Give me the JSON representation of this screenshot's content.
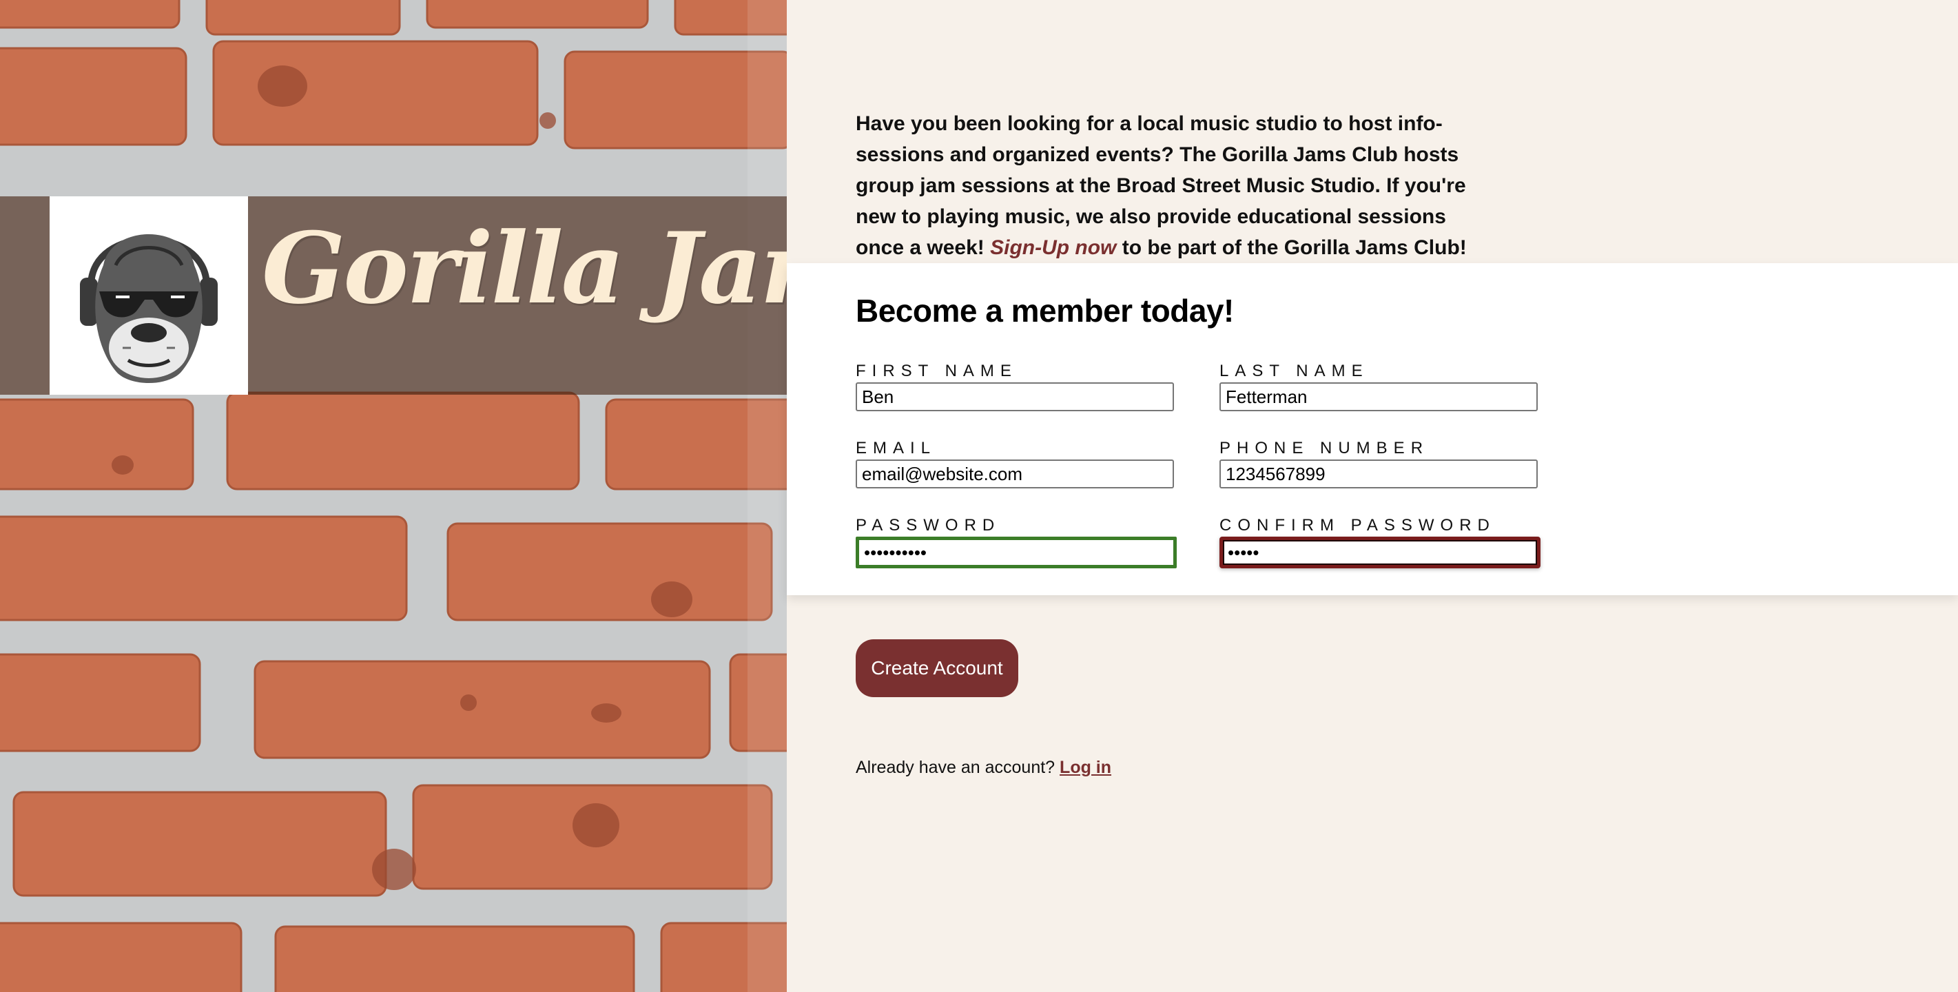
{
  "brand": {
    "logo_text": "Gorilla Jams"
  },
  "intro": {
    "text_before": "Have you been looking for a local music studio to host info-sessions and organized events? The Gorilla Jams Club hosts group jam sessions at the Broad Street Music Studio. If you're new to playing music, we also provide educational sessions once a week! ",
    "signup_link": "Sign-Up now",
    "text_after": " to be part of the Gorilla Jams Club!"
  },
  "form": {
    "title": "Become a member today!",
    "first_name": {
      "label": "FIRST NAME",
      "value": "Ben"
    },
    "last_name": {
      "label": "LAST NAME",
      "value": "Fetterman"
    },
    "email": {
      "label": "EMAIL",
      "value": "email@website.com"
    },
    "phone": {
      "label": "PHONE NUMBER",
      "value": "1234567899"
    },
    "password": {
      "label": "PASSWORD",
      "value": "1234567890",
      "state": "valid"
    },
    "confirm_password": {
      "label": "CONFIRM PASSWORD",
      "value": "12345",
      "state": "invalid"
    },
    "submit_label": "Create Account"
  },
  "login": {
    "prompt": "Already have an account? ",
    "link_label": "Log in"
  },
  "colors": {
    "background": "#f7f1ea",
    "accent": "#7a3030",
    "valid": "#3b7d28",
    "invalid": "#7a1c1c",
    "logo_text": "#fbecd4"
  },
  "icons": {
    "logo": "gorilla-with-headphones-icon"
  }
}
